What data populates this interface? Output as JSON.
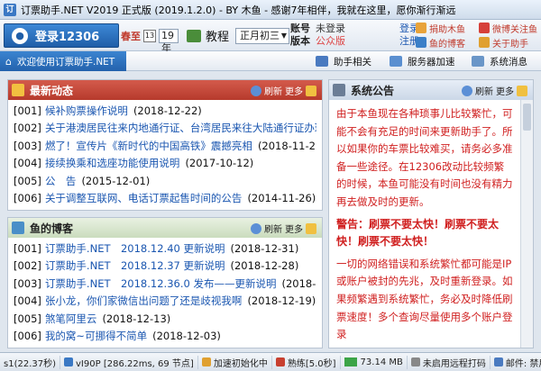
{
  "window": {
    "title": "订票助手.NET V2019 正式版 (2019.1.2.0) - BY 木鱼 - 感谢7年相伴，我就在这里，愿你渐行渐远"
  },
  "header": {
    "login_label": "登录12306",
    "chunjie_label": "春至",
    "calendar_text": "13",
    "day_value": "19年",
    "tutorial_label": "教程",
    "lunar_value": "正月初三",
    "account_label": "账号",
    "account_value": "未登录",
    "version_label": "版本",
    "version_value": "公众版",
    "login_link": "登录",
    "register_link": "注册",
    "ext_links": [
      "捐助木鱼",
      "微博关注鱼",
      "鱼的博客",
      "关于助手"
    ]
  },
  "nav": {
    "home_label": "欢迎使用订票助手.NET",
    "items": [
      "助手相关",
      "服务器加速",
      "系统消息"
    ]
  },
  "panels": {
    "news": {
      "title": "最新动态",
      "refresh": "刷新",
      "more": "更多",
      "items": [
        {
          "num": "[001]",
          "text": "候补购票操作说明",
          "date": "(2018-12-22)"
        },
        {
          "num": "[002]",
          "text": "关于港澳居民往来内地通行证、台湾居民来往大陆通行证办理",
          "date": ""
        },
        {
          "num": "[003]",
          "text": "燃了！宣传片《新时代的中国高铁》震撼亮相",
          "date": "(2018-11-2"
        },
        {
          "num": "[004]",
          "text": "接续换乘和选座功能使用说明",
          "date": "(2017-10-12)"
        },
        {
          "num": "[005]",
          "text": "公　告",
          "date": "(2015-12-01)"
        },
        {
          "num": "[006]",
          "text": "关于调整互联网、电话订票起售时间的公告",
          "date": "(2014-11-26)"
        }
      ]
    },
    "blog": {
      "title": "鱼的博客",
      "refresh": "刷新",
      "more": "更多",
      "items": [
        {
          "num": "[001]",
          "text": "订票助手.NET　2018.12.40 更新说明",
          "date": "(2018-12-31)"
        },
        {
          "num": "[002]",
          "text": "订票助手.NET　2018.12.37 更新说明",
          "date": "(2018-12-28)"
        },
        {
          "num": "[003]",
          "text": "订票助手.NET　2018.12.36.0 发布——更新说明",
          "date": "(2018-12-28"
        },
        {
          "num": "[004]",
          "text": "张小龙，你们家微信出问题了还是歧视我啊",
          "date": "(2018-12-19)"
        },
        {
          "num": "[005]",
          "text": "煞笔阿里云",
          "date": "(2018-12-13)"
        },
        {
          "num": "[006]",
          "text": "我的窝~可挪得不简单",
          "date": "(2018-12-03)"
        }
      ]
    },
    "notice": {
      "title": "系统公告",
      "refresh": "刷新",
      "more": "更多",
      "para1": "由于本鱼现在各种琐事儿比较繁忙，可能不会有充足的时间来更新助手了。所以如果你的车票比较难买，请务必多准备一些途径。在12306改动比较频繁的时候，本鱼可能没有时间也没有精力再去做及时的更新。",
      "warn": "警告：刷票不要太快！刷票不要太快！刷票不要太快！",
      "para2": "一切的网络错误和系统繁忙都可能是IP或账户被封的先兆，及时重新登录。如果频繁遇到系统繁忙，务必及时降低刷票速度！多个查询尽量使用多个账户登录"
    }
  },
  "status": {
    "items": [
      "s1(22.37秒)",
      "vI90P [286.22ms, 69 节点]",
      "加速初始化中",
      "熟练[5.0秒]",
      "73.14 MB",
      "未启用远程打码",
      "邮件: 禁用",
      "统计"
    ]
  },
  "colors": {
    "accent": "#2362ad",
    "news_head": "#c0443a",
    "notice_text": "#d02020",
    "link": "#1a56b0"
  }
}
